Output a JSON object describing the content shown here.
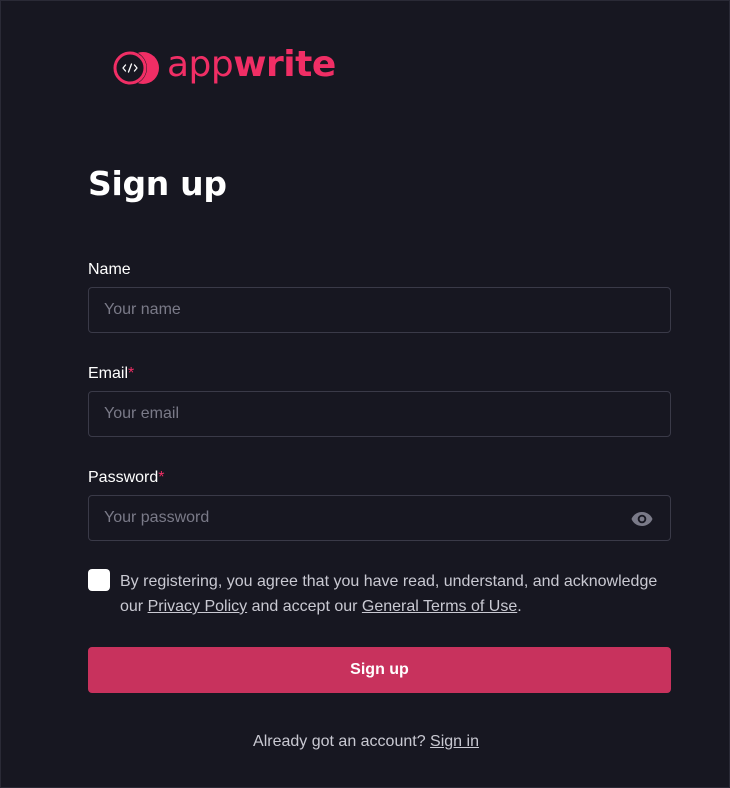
{
  "brand": {
    "name_light": "app",
    "name_bold": "write",
    "logo_icon": "code-brackets-icon",
    "color": "#f02e65"
  },
  "title": "Sign up",
  "form": {
    "name": {
      "label": "Name",
      "required": false,
      "placeholder": "Your name",
      "value": ""
    },
    "email": {
      "label": "Email",
      "required": true,
      "required_mark": "*",
      "placeholder": "Your email",
      "value": ""
    },
    "password": {
      "label": "Password",
      "required": true,
      "required_mark": "*",
      "placeholder": "Your password",
      "value": "",
      "toggle_icon": "eye-icon"
    },
    "terms": {
      "checked": false,
      "text_before": "By registering, you agree that you have read, understand, and acknowledge our ",
      "privacy_link": "Privacy Policy",
      "text_middle": " and accept our ",
      "terms_link": "General Terms of Use",
      "text_after": "."
    },
    "submit_label": "Sign up"
  },
  "footer": {
    "text": "Already got an account?",
    "link": "Sign in"
  },
  "colors": {
    "background": "#171721",
    "accent": "#f02e65",
    "button": "#c8325d",
    "input_border": "#3a3a48"
  }
}
